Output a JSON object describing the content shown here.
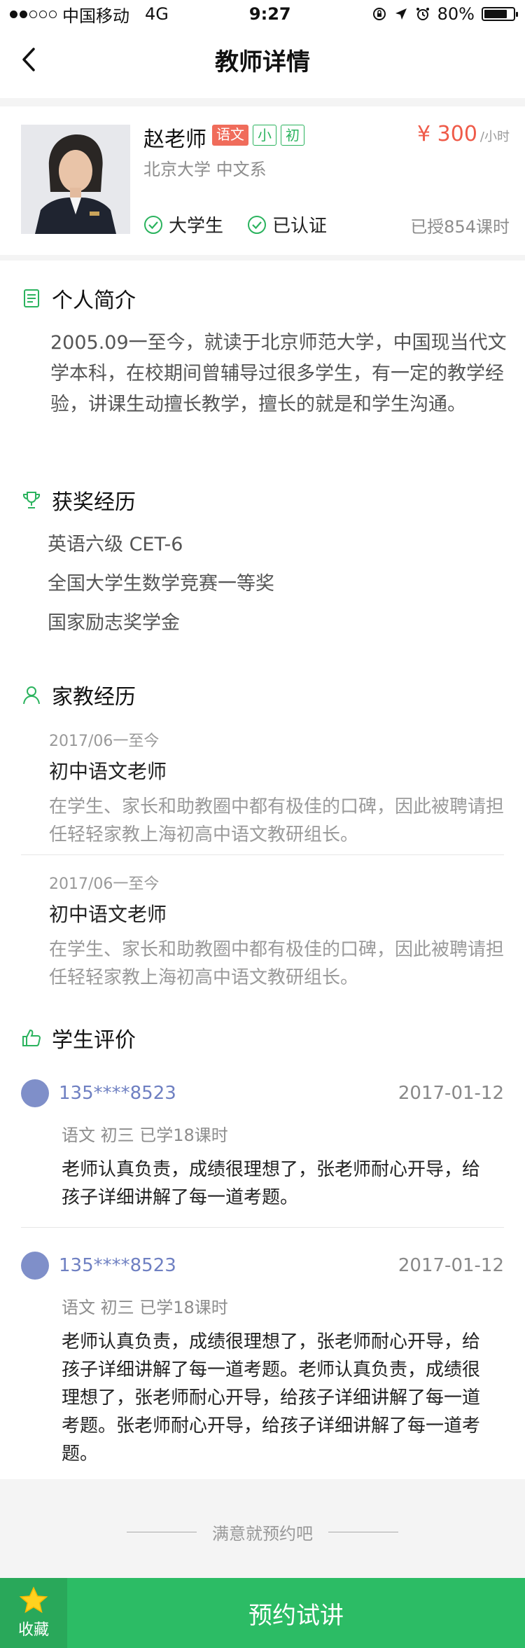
{
  "status_bar": {
    "carrier": "中国移动",
    "network": "4G",
    "time": "9:27",
    "battery": "80%",
    "battery_level": 0.8
  },
  "nav": {
    "title": "教师详情"
  },
  "teacher": {
    "name": "赵老师",
    "subject_tag": "语文",
    "level_tags": [
      "小",
      "初"
    ],
    "price": "¥ 300",
    "price_unit": "/小时",
    "school": "北京大学  中文系",
    "badges": [
      "大学生",
      "已认证"
    ],
    "taught_hours": "已授854课时"
  },
  "intro": {
    "title": "个人简介",
    "text": "2005.09一至今，就读于北京师范大学，中国现当代文学本科，在校期间曾辅导过很多学生，有一定的教学经验，讲课生动擅长教学，擅长的就是和学生沟通。"
  },
  "awards": {
    "title": "获奖经历",
    "items": [
      "英语六级 CET-6",
      "全国大学生数学竞赛一等奖",
      "国家励志奖学金"
    ]
  },
  "experience": {
    "title": "家教经历",
    "items": [
      {
        "date": "2017/06一至今",
        "role": "初中语文老师",
        "desc": "在学生、家长和助教圈中都有极佳的口碑，因此被聘请担任轻轻家教上海初高中语文教研组长。"
      },
      {
        "date": "2017/06一至今",
        "role": "初中语文老师",
        "desc": "在学生、家长和助教圈中都有极佳的口碑，因此被聘请担任轻轻家教上海初高中语文教研组长。"
      }
    ]
  },
  "reviews": {
    "title": "学生评价",
    "items": [
      {
        "user": "135****8523",
        "date": "2017-01-12",
        "meta": "语文  初三  已学18课时",
        "text": "老师认真负责，成绩很理想了，张老师耐心开导，给孩子详细讲解了每一道考题。"
      },
      {
        "user": "135****8523",
        "date": "2017-01-12",
        "meta": "语文  初三  已学18课时",
        "text": "老师认真负责，成绩很理想了，张老师耐心开导，给孩子详细讲解了每一道考题。老师认真负责，成绩很理想了，张老师耐心开导，给孩子详细讲解了每一道考题。张老师耐心开导，给孩子详细讲解了每一道考题。"
      }
    ]
  },
  "footer": {
    "note": "满意就预约吧",
    "favorite_label": "收藏",
    "book_label": "预约试讲"
  },
  "colors": {
    "accent_green": "#2cbc65",
    "price_red": "#ef5b49",
    "tag_red": "#f06c5b",
    "link_blue": "#6f80c2"
  }
}
